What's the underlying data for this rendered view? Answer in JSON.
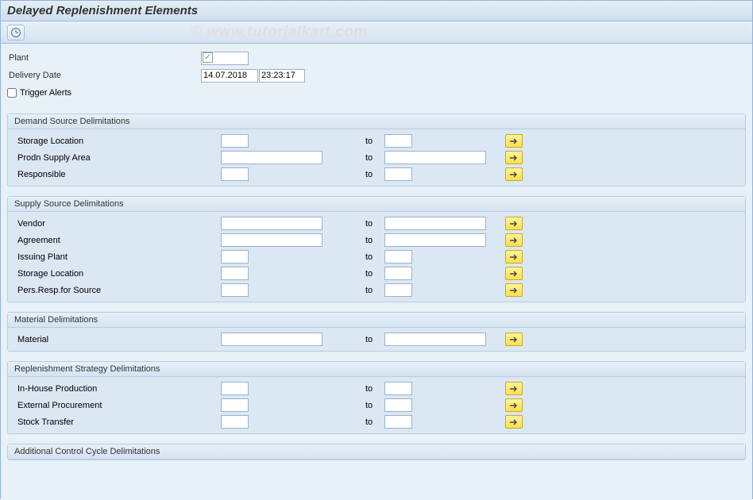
{
  "title": "Delayed Replenishment Elements",
  "watermark": "© www.tutorialkart.com",
  "header": {
    "plant_label": "Plant",
    "delivery_date_label": "Delivery Date",
    "delivery_date_value": "14.07.2018",
    "delivery_time_value": "23:23:17",
    "trigger_alerts_label": "Trigger Alerts"
  },
  "to_label": "to",
  "groups": [
    {
      "title": "Demand Source Delimitations",
      "rows": [
        {
          "label": "Storage Location",
          "width": "short"
        },
        {
          "label": "Prodn Supply Area",
          "width": "long"
        },
        {
          "label": "Responsible",
          "width": "short"
        }
      ]
    },
    {
      "title": "Supply Source Delimitations",
      "rows": [
        {
          "label": "Vendor",
          "width": "long"
        },
        {
          "label": "Agreement",
          "width": "long"
        },
        {
          "label": "Issuing Plant",
          "width": "short"
        },
        {
          "label": "Storage Location",
          "width": "short"
        },
        {
          "label": "Pers.Resp.for Source",
          "width": "short"
        }
      ]
    },
    {
      "title": "Material Delimitations",
      "rows": [
        {
          "label": "Material",
          "width": "long"
        }
      ]
    },
    {
      "title": "Replenishment Strategy Delimitations",
      "rows": [
        {
          "label": "In-House Production",
          "width": "short"
        },
        {
          "label": "External Procurement",
          "width": "short"
        },
        {
          "label": "Stock Transfer",
          "width": "short"
        }
      ]
    },
    {
      "title": "Additional Control Cycle Delimitations",
      "rows": []
    }
  ]
}
